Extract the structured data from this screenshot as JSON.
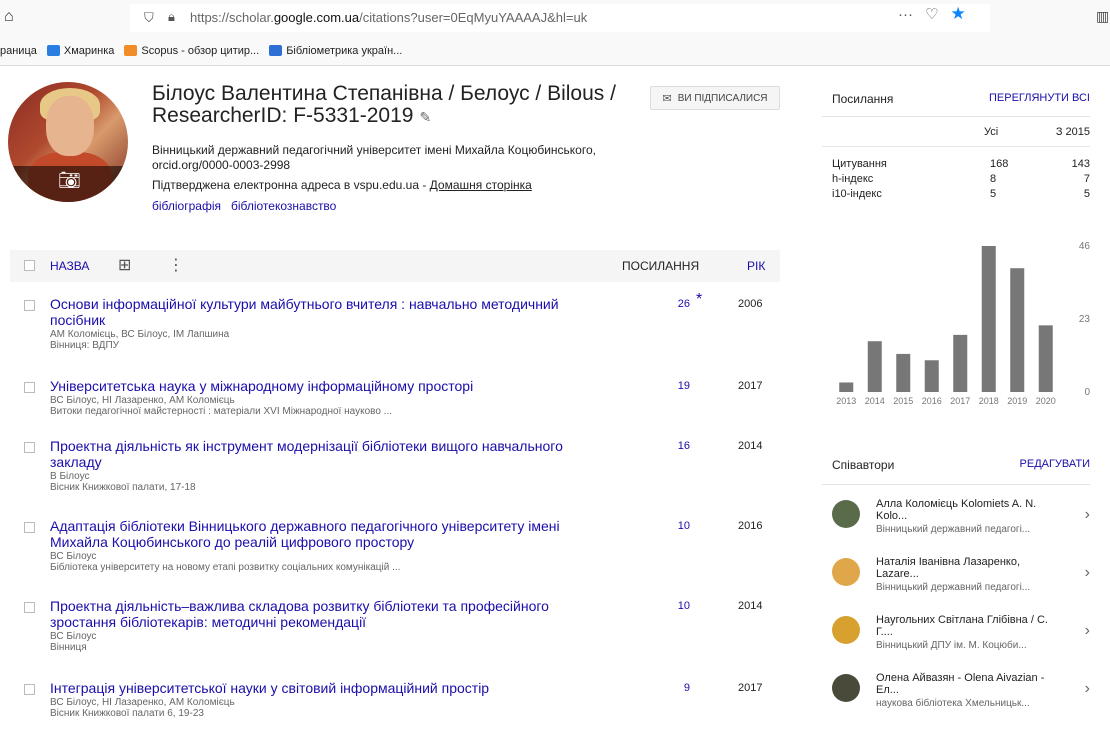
{
  "browser": {
    "url_prefix": "https://scholar.",
    "url_domain": "google.com.ua",
    "url_suffix": "/citations?user=0EqMyuYAAAAJ&hl=uk",
    "more": "···",
    "bookmarks": [
      {
        "label": "раница",
        "color": ""
      },
      {
        "label": "Хмаринка",
        "color": "#2a7de1"
      },
      {
        "label": "Scopus - обзор цитир...",
        "color": "#f28c28"
      },
      {
        "label": "Бібліометрика україн...",
        "color": "#2e6fd6"
      }
    ]
  },
  "profile": {
    "name": "Білоус Валентина Степанівна / Белоус / Bilous / ResearcherID: F-5331-2019",
    "follow_label": "ВИ ПІДПИСАЛИСЯ",
    "affiliation": "Вінницький державний педагогічний університет імені Михайла Коцюбинського, orcid.org/0000-0003-2998",
    "verified_text": "Підтверджена електронна адреса в vspu.edu.ua - ",
    "homepage_label": "Домашня сторінка",
    "interests": [
      "бібліографія",
      "бібліотекознавство"
    ]
  },
  "table": {
    "col_title": "НАЗВА",
    "col_cited": "ПОСИЛАННЯ",
    "col_year": "РІК",
    "rows": [
      {
        "title": "Основи інформаційної культури майбутнього вчителя : навчально методичний посібник",
        "authors": "АМ Коломієць, ВС Білоус, ІМ Лапшина",
        "venue": "Вінниця: ВДПУ",
        "cited": "26",
        "star": "*",
        "year": "2006"
      },
      {
        "title": "Університетська наука у міжнародному інформаційному просторі",
        "authors": "ВС Білоус, НІ Лазаренко, АМ Коломієць",
        "venue": "Витоки педагогічної майстерності : матеріали XVI Міжнародної науково ...",
        "cited": "19",
        "star": "",
        "year": "2017"
      },
      {
        "title": "Проектна діяльність як інструмент модернізації бібліотеки вищого навчального закладу",
        "authors": "В Білоус",
        "venue": "Вісник Книжкової палати, 17-18",
        "cited": "16",
        "star": "",
        "year": "2014"
      },
      {
        "title": "Адаптація бібліотеки Вінницького державного педагогічного університету імені Михайла Коцюбинського до реалій цифрового простору",
        "authors": "ВС Білоус",
        "venue": "Бібліотека університету на новому етапі розвитку соціальних комунікацій ...",
        "cited": "10",
        "star": "",
        "year": "2016"
      },
      {
        "title": "Проектна діяльність–важлива складова розвитку бібліотеки та професійного зростання бібліотекарів: методичні рекомендації",
        "authors": "ВС Білоус",
        "venue": "Вінниця",
        "cited": "10",
        "star": "",
        "year": "2014"
      },
      {
        "title": "Інтеграція університетської науки у світовий інформаційний простір",
        "authors": "ВС Білоус, НІ Лазаренко, АМ Коломієць",
        "venue": "Вісник Книжкової палати 6, 19-23",
        "cited": "9",
        "star": "",
        "year": "2017"
      }
    ]
  },
  "cited_by": {
    "title": "Посилання",
    "view_all": "ПЕРЕГЛЯНУТИ ВСІ",
    "col_all": "Усі",
    "col_since": "З 2015",
    "rows": [
      {
        "label": "Цитування",
        "all": "168",
        "since": "143"
      },
      {
        "label": "h-індекс",
        "all": "8",
        "since": "7"
      },
      {
        "label": "i10-індекс",
        "all": "5",
        "since": "5"
      }
    ]
  },
  "chart_data": {
    "type": "bar",
    "categories": [
      "2013",
      "2014",
      "2015",
      "2016",
      "2017",
      "2018",
      "2019",
      "2020"
    ],
    "values": [
      3,
      16,
      12,
      10,
      18,
      46,
      39,
      21
    ],
    "yticks": [
      "0",
      "23",
      "46"
    ],
    "ylim": [
      0,
      46
    ],
    "bar_color": "#777777"
  },
  "coauthors": {
    "title": "Співавтори",
    "edit": "РЕДАГУВАТИ",
    "items": [
      {
        "name": "Алла Коломієць Kolomiets A. N. Kolo...",
        "aff": "Вінницький державний педагогі...",
        "color": "#5a6b4a"
      },
      {
        "name": "Наталія Іванівна Лазаренко, Lazare...",
        "aff": "Вінницький державний педагогі...",
        "color": "#e0a64a"
      },
      {
        "name": "Наугольних Світлана Глібівна / С. Г....",
        "aff": "Вінницький ДПУ ім. М. Коцюби...",
        "color": "#d8a02e"
      },
      {
        "name": "Олена Айвазян - Olena Aivazian - Ел...",
        "aff": "наукова бібліотека Хмельницьк...",
        "color": "#4a4a3a"
      }
    ]
  }
}
